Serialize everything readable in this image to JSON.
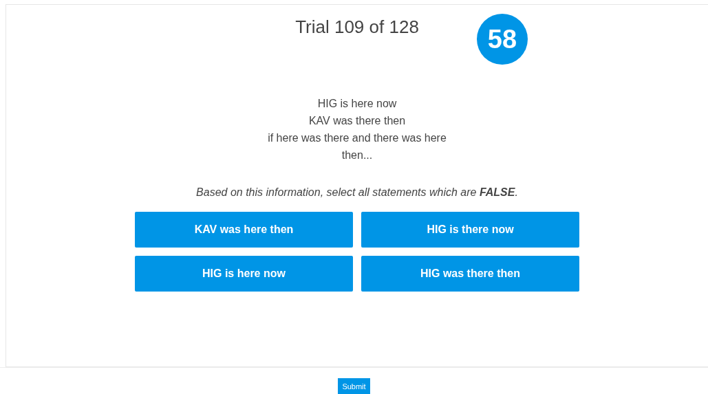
{
  "title": "Trial 109 of 128",
  "timer": "58",
  "premises": [
    "HIG is here now",
    "KAV was there then",
    "if here was there and there was here",
    "then..."
  ],
  "instruction": "Based on this information, select all statements which are **FALSE**.",
  "options": [
    {
      "label": "KAV was here then",
      "selected": false
    },
    {
      "label": "HIG is there now",
      "selected": false
    },
    {
      "label": "HIG is here now",
      "selected": false
    },
    {
      "label": "HIG was there then",
      "selected": false
    }
  ],
  "submit": "Submit"
}
